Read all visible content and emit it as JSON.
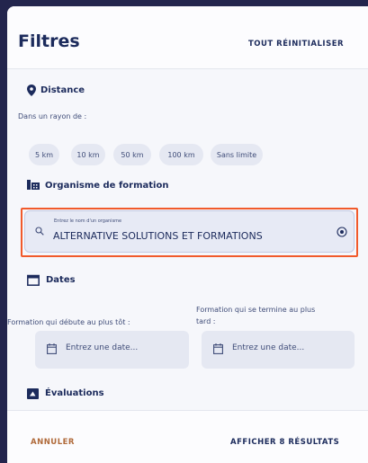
{
  "header": {
    "title": "Filtres",
    "reset_label": "TOUT RÉINITIALISER"
  },
  "distance": {
    "title": "Distance",
    "subtitle": "Dans un rayon de :",
    "options": [
      "5 km",
      "10 km",
      "50 km",
      "100 km",
      "Sans limite"
    ]
  },
  "organisme": {
    "title": "Organisme de formation",
    "placeholder": "Entrez le nom d'un organisme",
    "value": "ALTERNATIVE SOLUTIONS ET FORMATIONS"
  },
  "dates": {
    "title": "Dates",
    "start_label": "Formation qui débute au plus tôt :",
    "end_label_line1": "Formation qui se termine au plus",
    "end_label_line2": "tard :",
    "start_placeholder": "Entrez une date...",
    "end_placeholder": "Entrez une date..."
  },
  "evaluations": {
    "title": "Évaluations"
  },
  "footer": {
    "cancel_label": "ANNULER",
    "show_label": "AFFICHER 8 RÉSULTATS"
  },
  "colors": {
    "background": "#23254d",
    "panel": "#f6f7fb",
    "text_primary": "#1c2b5c",
    "highlight": "#f15a2b",
    "cancel": "#b06a3a"
  }
}
